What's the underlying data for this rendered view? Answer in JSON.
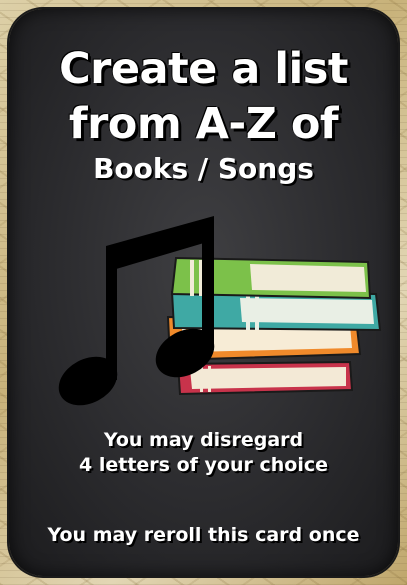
{
  "card": {
    "title_line1": "Create a list",
    "title_line2": "from A-Z of",
    "subtitle": "Books / Songs",
    "rule_line1": "You may disregard",
    "rule_line2": "4 letters of your choice",
    "footer": "You may reroll this card once"
  },
  "illustration": {
    "icons": [
      "music-note-icon",
      "book-stack-icon"
    ],
    "book_colors": [
      "#7cc14a",
      "#3fa9a4",
      "#f08a2b",
      "#d9435a"
    ]
  }
}
